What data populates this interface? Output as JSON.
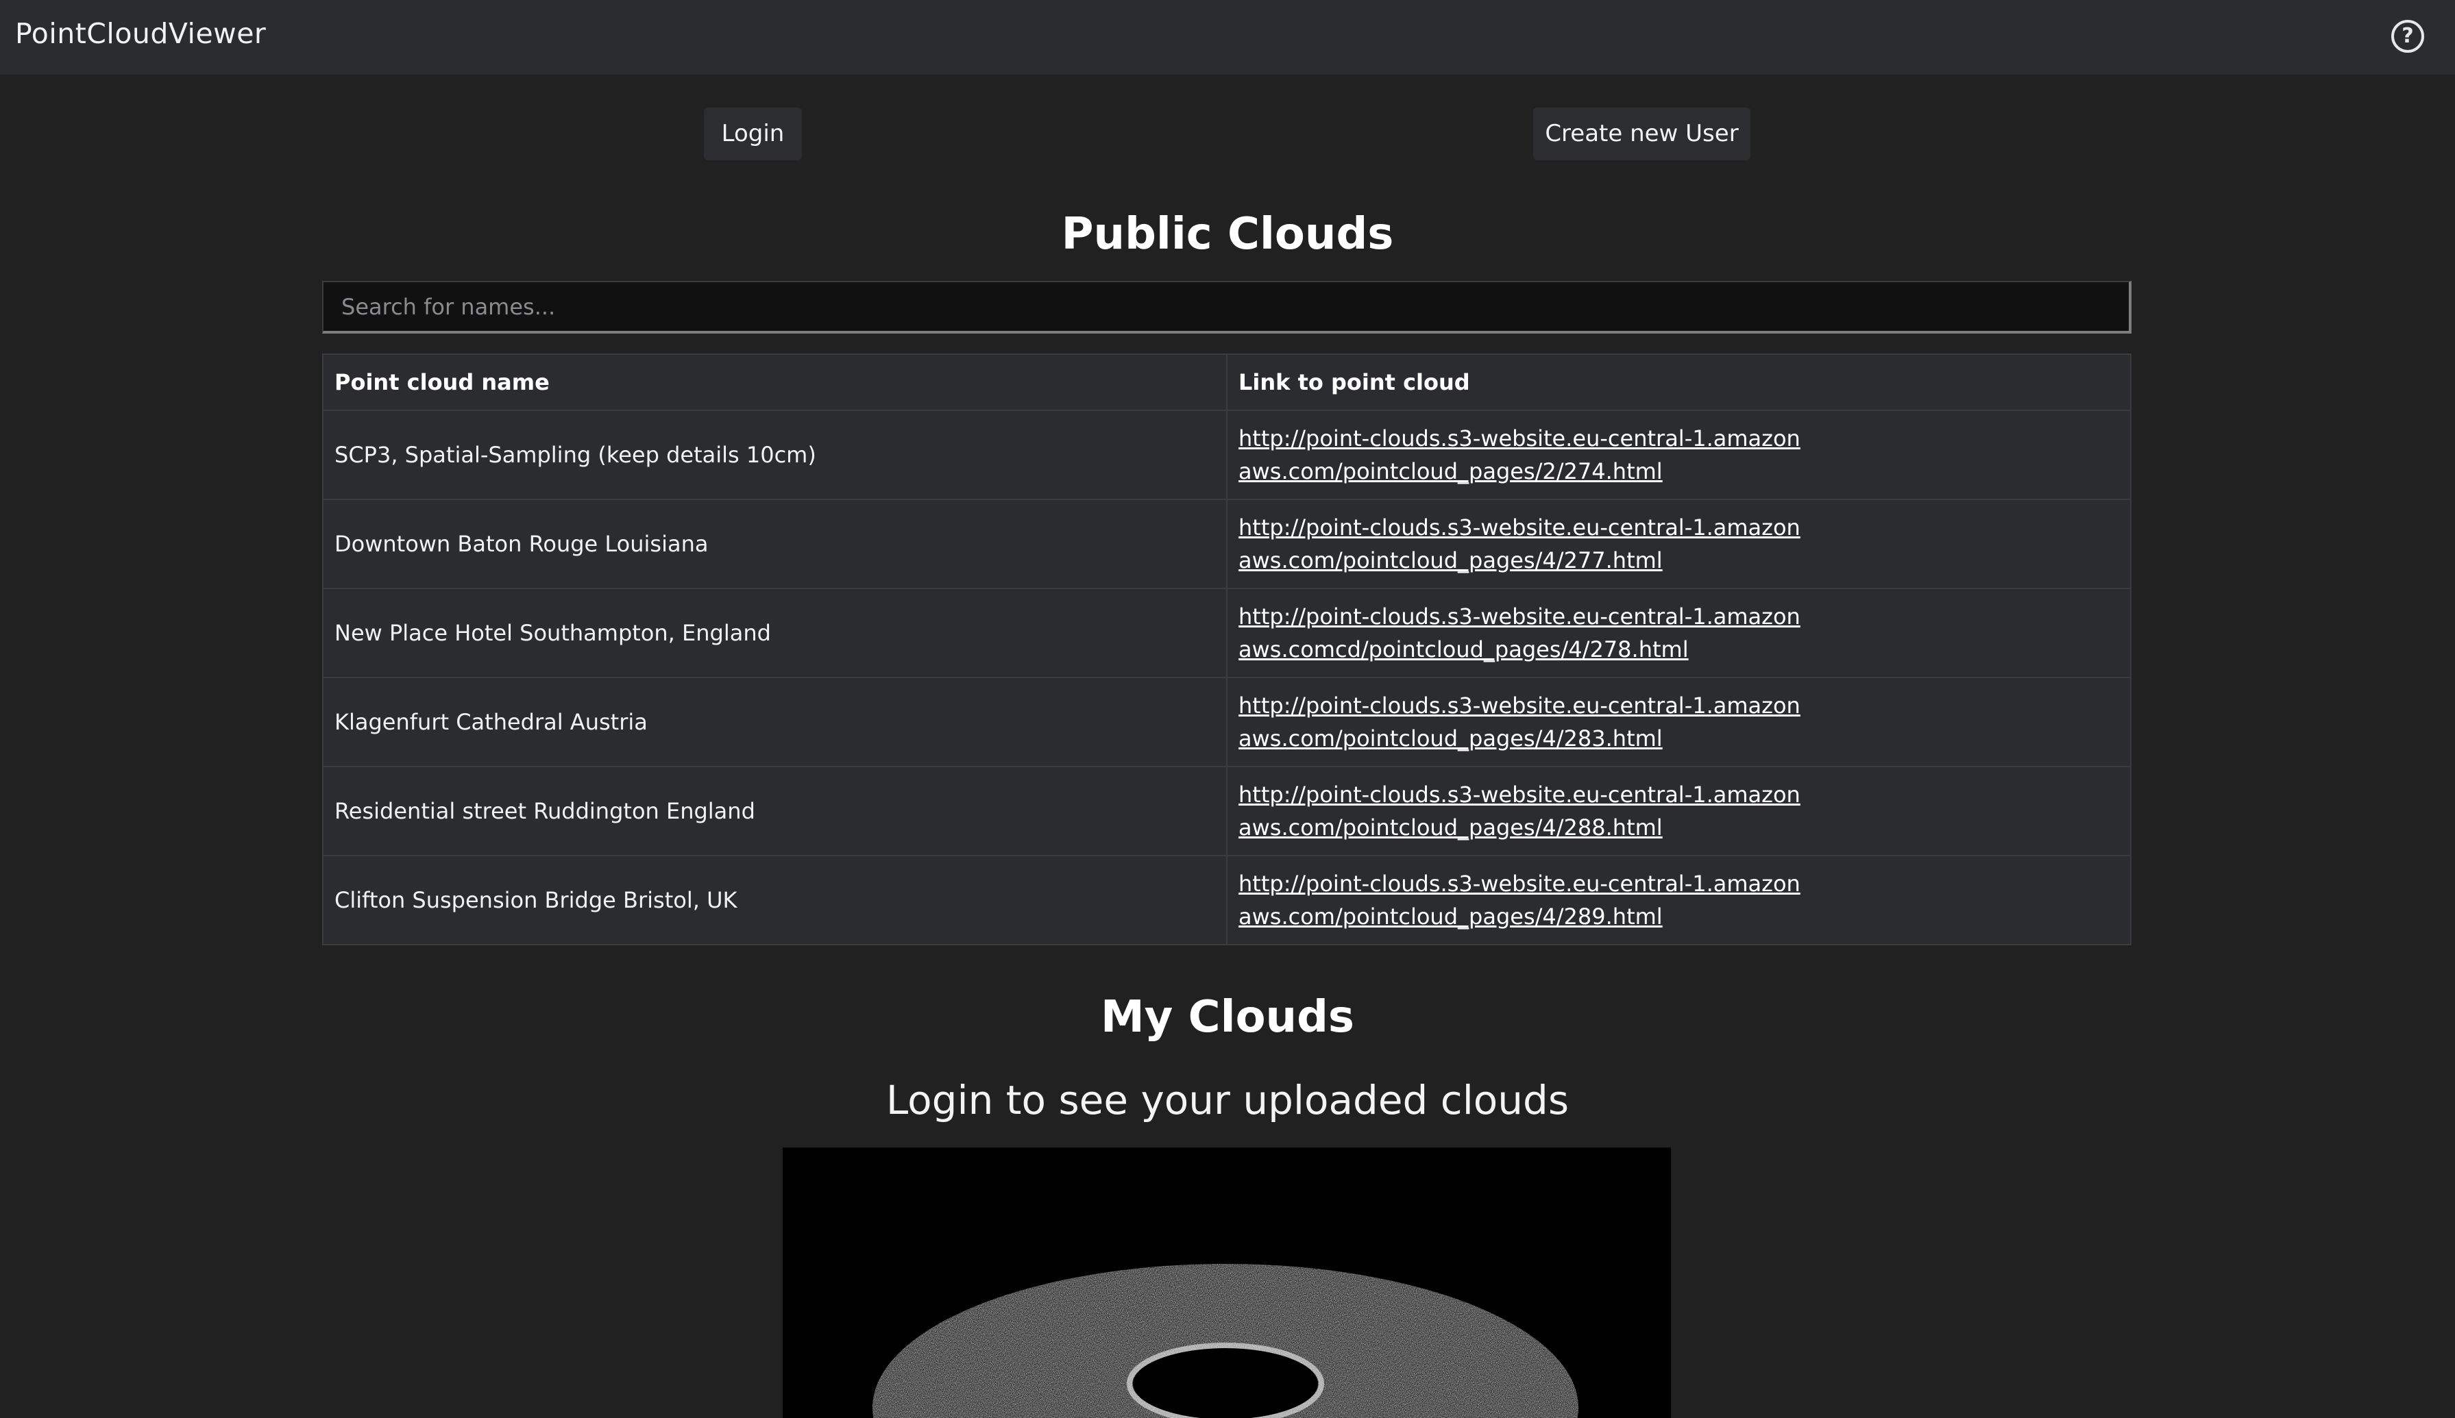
{
  "app": {
    "title": "PointCloudViewer",
    "help_icon": "question-circle-icon"
  },
  "auth": {
    "login_label": "Login",
    "create_user_label": "Create new User"
  },
  "public_clouds": {
    "heading": "Public Clouds",
    "search_placeholder": "Search for names...",
    "columns": [
      "Point cloud name",
      "Link to point cloud"
    ],
    "rows": [
      {
        "name": "SCP3, Spatial-Sampling (keep details 10cm)",
        "link": "http://point-clouds.s3-website.eu-central-1.amazonaws.com/pointcloud_pages/2/274.html"
      },
      {
        "name": "Downtown Baton Rouge Louisiana",
        "link": "http://point-clouds.s3-website.eu-central-1.amazonaws.com/pointcloud_pages/4/277.html"
      },
      {
        "name": "New Place Hotel Southampton, England",
        "link": "http://point-clouds.s3-website.eu-central-1.amazonaws.comcd/pointcloud_pages/4/278.html"
      },
      {
        "name": "Klagenfurt Cathedral Austria",
        "link": "http://point-clouds.s3-website.eu-central-1.amazonaws.com/pointcloud_pages/4/283.html"
      },
      {
        "name": "Residential street Ruddington England",
        "link": "http://point-clouds.s3-website.eu-central-1.amazonaws.com/pointcloud_pages/4/288.html"
      },
      {
        "name": "Clifton Suspension Bridge Bristol, UK",
        "link": "http://point-clouds.s3-website.eu-central-1.amazonaws.com/pointcloud_pages/4/289.html"
      }
    ]
  },
  "my_clouds": {
    "heading": "My Clouds",
    "login_message": "Login to see your uploaded clouds"
  }
}
